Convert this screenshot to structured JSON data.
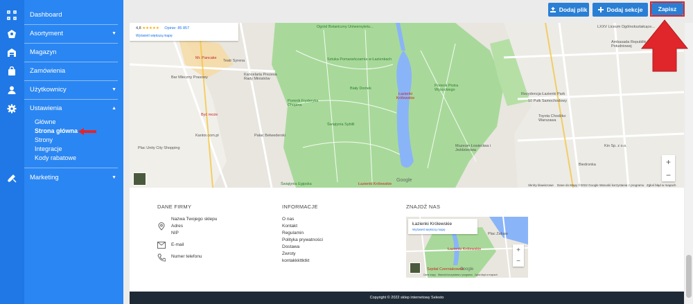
{
  "sidebar": {
    "items": [
      {
        "label": "Dashboard",
        "icon": "dashboard-icon",
        "expandable": false
      },
      {
        "label": "Asortyment",
        "icon": "assortment-icon",
        "expandable": true
      },
      {
        "label": "Magazyn",
        "icon": "warehouse-icon",
        "expandable": false
      },
      {
        "label": "Zamówienia",
        "icon": "orders-icon",
        "expandable": false
      },
      {
        "label": "Użytkownicy",
        "icon": "users-icon",
        "expandable": true
      },
      {
        "label": "Ustawienia",
        "icon": "settings-icon",
        "expandable": true,
        "expanded": true
      },
      {
        "label": "Marketing",
        "icon": "marketing-icon",
        "expandable": true
      }
    ],
    "settings_sub": [
      {
        "label": "Główne",
        "active": false
      },
      {
        "label": "Strona główna",
        "active": true
      },
      {
        "label": "Strony",
        "active": false
      },
      {
        "label": "Integracje",
        "active": false
      },
      {
        "label": "Kody rabatowe",
        "active": false
      }
    ]
  },
  "toolbar": {
    "add_file": "Dodaj plik",
    "add_section": "Dodaj sekcje",
    "save": "Zapisz"
  },
  "map": {
    "rating": "4,8",
    "stars": "★★★★★",
    "reviews": "Opinie: 85 857",
    "larger_map": "Wyświetl większą mapę",
    "labels": {
      "ogrod": "Ogród Botaniczny Uniwersytetu...",
      "liceum": "LXXV Liceum Ogólnokształcące...",
      "ambasada": "Ambasada Republiki Korei Południowej",
      "sztuka": "Sztuka Pomarańczarnia w Łazienkach",
      "teatr": "Teatr Syrena",
      "pancake": "Mr. Pancake",
      "mleczny": "Bar Mleczny Prasowy",
      "kancelaria": "Kancelaria Prezesa Rady Ministrów",
      "bialy": "Biały Domek",
      "lazienki": "Łazienki Królewskie",
      "wysockiego": "Pomnik Piotra Wysockiego",
      "rezydencja": "Rezydencja Łazienki Park",
      "pulk": "10 Pułk Samochodowy",
      "chopin": "Pomnik Fryderyka Chopina",
      "sybilli": "Świątynia Sybilli",
      "belweder": "Pałac Belwederski",
      "byc": "Być może",
      "kantor": "Kantor.com.pl",
      "unity": "Plac Unity City Shopping",
      "diana": "Świątynia Egipska",
      "lazienki_bottom": "Łazienki Królewskie",
      "muzeum": "Muzeum Łowiectwa i Jeździectwa",
      "toyota": "Toyota Chodźko Warszawa",
      "kin": "Kin Sp. z o.o.",
      "biedronka": "Biedronka",
      "google": "Google"
    },
    "attribution": {
      "keys": "Skróty klawiszowe",
      "data": "Dane do Mapy ©2022 Google",
      "terms": "Warunki korzystania z programu",
      "report": "Zgłoś błąd w mapach"
    },
    "zoom_in": "+",
    "zoom_out": "−"
  },
  "footer": {
    "company_heading": "DANE FIRMY",
    "shop_name": "Nazwa Twojego sklepu",
    "address": "Adres",
    "nip": "NIP",
    "email": "E-mail",
    "phone": "Numer telefonu",
    "info_heading": "INFORMACJE",
    "info_links": [
      "O nas",
      "Kontakt",
      "Regulamin",
      "Polityka prywatności",
      "Dostawa",
      "Zwroty",
      "kontakkkttktkt"
    ],
    "find_heading": "ZNAJDŹ NAS",
    "minimap": {
      "place": "Łazienki Królewskie",
      "larger_map": "Wyświetl większą mapę",
      "label_plac": "Plac Zabaw",
      "label_lazienki": "Łazienki Królewskie",
      "label_szpital": "Szpital Czerniakowski",
      "google": "Google",
      "attribution": "Dane mapy   Warunki korzystania z programu   Zgłoś błąd w mapach"
    },
    "copyright": "Copyright © 2022 sklep internetowy Selesto"
  },
  "colors": {
    "sidebar": "#2a86f2",
    "iconstrip": "#1f78e6",
    "button": "#2a7fd4",
    "annotation_red": "#e0262b",
    "footer_dark": "#1e2a36"
  }
}
